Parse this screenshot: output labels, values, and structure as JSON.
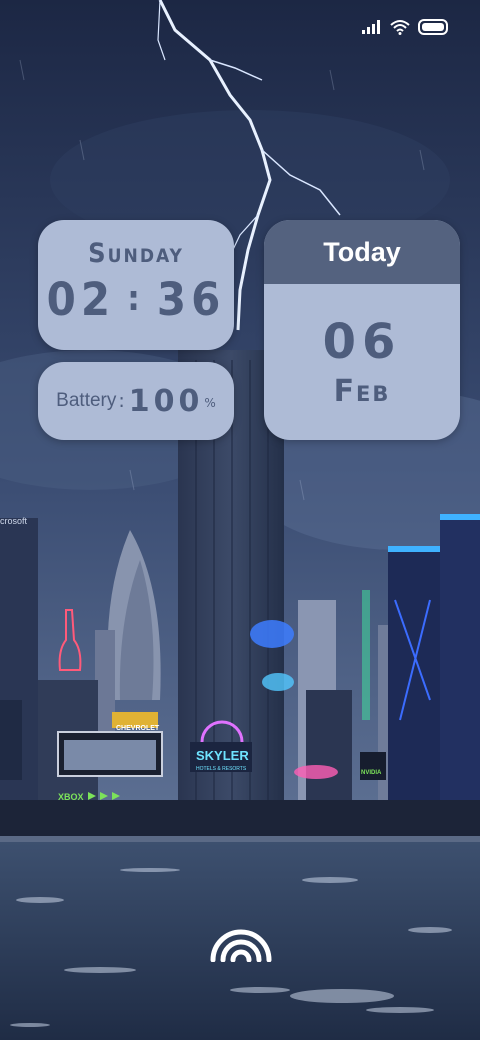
{
  "status_bar": {
    "icons": [
      "signal-icon",
      "wifi-icon",
      "battery-icon"
    ]
  },
  "clock_widget": {
    "day": "Sunday",
    "hours": "02",
    "separator": ":",
    "minutes": "36"
  },
  "battery_widget": {
    "label": "Battery",
    "separator": ":",
    "value": "100",
    "unit": "%"
  },
  "date_widget": {
    "header": "Today",
    "day_number": "06",
    "month": "Feb"
  },
  "wallpaper": {
    "signs": {
      "brand_1": "CHEVROLET",
      "brand_2": "SKYLER",
      "brand_2_sub": "HOTELS & RESORTS",
      "brand_3": "XBOX",
      "brand_4": "NVIDIA",
      "brand_5": "crosoft"
    }
  },
  "unlock": {
    "icon": "fingerprint-arc-icon"
  },
  "colors": {
    "widget_bg": "#aebbd6",
    "widget_text": "#4e5d7d",
    "header_bg": "#54627f"
  }
}
